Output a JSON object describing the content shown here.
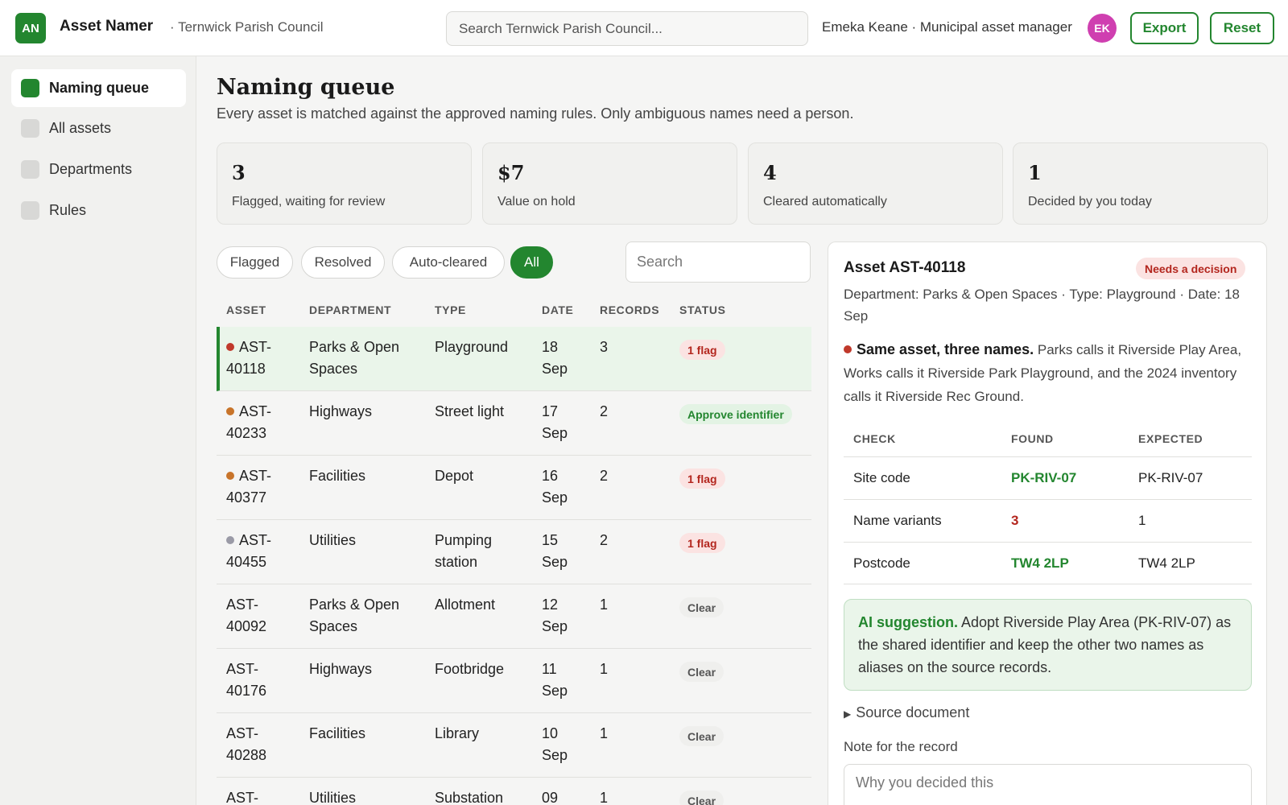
{
  "app": {
    "logo_text": "AN",
    "title": "Asset Namer",
    "org": "· Ternwick Parish Council",
    "search_placeholder": "Search Ternwick Parish Council...",
    "user_line": "Emeka Keane · Municipal asset manager",
    "avatar": "EK",
    "export_label": "Export",
    "reset_label": "Reset"
  },
  "sidebar": {
    "items": [
      {
        "label": "Naming queue",
        "active": true
      },
      {
        "label": "All assets",
        "active": false
      },
      {
        "label": "Departments",
        "active": false
      },
      {
        "label": "Rules",
        "active": false
      }
    ]
  },
  "main": {
    "title": "Naming queue",
    "subtitle": "Every asset is matched against the approved naming rules. Only ambiguous names need a person.",
    "stats": [
      {
        "value": "3",
        "label": "Flagged, waiting for review"
      },
      {
        "value": "$7",
        "label": "Value on hold"
      },
      {
        "value": "4",
        "label": "Cleared automatically"
      },
      {
        "value": "1",
        "label": "Decided by you today"
      }
    ],
    "filters": [
      "Flagged",
      "Resolved",
      "Auto-cleared",
      "All"
    ],
    "active_filter": "All",
    "list_search_placeholder": "Search"
  },
  "table": {
    "columns": [
      "ASSET",
      "DEPARTMENT",
      "TYPE",
      "DATE",
      "RECORDS",
      "STATUS"
    ],
    "rows": [
      {
        "asset_a": "AST-",
        "asset_b": "40118",
        "dot": "#c0392b",
        "dept_a": "Parks & Open",
        "dept_b": "Spaces",
        "type_a": "Playground",
        "type_b": "",
        "date_a": "18",
        "date_b": "Sep",
        "records": "3",
        "status": "1 flag",
        "status_kind": "flag",
        "selected": true
      },
      {
        "asset_a": "AST-",
        "asset_b": "40233",
        "dot": "#c8742a",
        "dept_a": "Highways",
        "dept_b": "",
        "type_a": "Street light",
        "type_b": "",
        "date_a": "17",
        "date_b": "Sep",
        "records": "2",
        "status": "Approve identifier",
        "status_kind": "approve",
        "selected": false
      },
      {
        "asset_a": "AST-",
        "asset_b": "40377",
        "dot": "#c8742a",
        "dept_a": "Facilities",
        "dept_b": "",
        "type_a": "Depot",
        "type_b": "",
        "date_a": "16",
        "date_b": "Sep",
        "records": "2",
        "status": "1 flag",
        "status_kind": "flag",
        "selected": false
      },
      {
        "asset_a": "AST-",
        "asset_b": "40455",
        "dot": "#9a9aa6",
        "dept_a": "Utilities",
        "dept_b": "",
        "type_a": "Pumping",
        "type_b": "station",
        "date_a": "15",
        "date_b": "Sep",
        "records": "2",
        "status": "1 flag",
        "status_kind": "flag",
        "selected": false
      },
      {
        "asset_a": "AST-",
        "asset_b": "40092",
        "dot": "",
        "dept_a": "Parks & Open",
        "dept_b": "Spaces",
        "type_a": "Allotment",
        "type_b": "",
        "date_a": "12",
        "date_b": "Sep",
        "records": "1",
        "status": "Clear",
        "status_kind": "clear",
        "selected": false
      },
      {
        "asset_a": "AST-",
        "asset_b": "40176",
        "dot": "",
        "dept_a": "Highways",
        "dept_b": "",
        "type_a": "Footbridge",
        "type_b": "",
        "date_a": "11",
        "date_b": "Sep",
        "records": "1",
        "status": "Clear",
        "status_kind": "clear",
        "selected": false
      },
      {
        "asset_a": "AST-",
        "asset_b": "40288",
        "dot": "",
        "dept_a": "Facilities",
        "dept_b": "",
        "type_a": "Library",
        "type_b": "",
        "date_a": "10",
        "date_b": "Sep",
        "records": "1",
        "status": "Clear",
        "status_kind": "clear",
        "selected": false
      },
      {
        "asset_a": "AST-",
        "asset_b": "",
        "dot": "",
        "dept_a": "Utilities",
        "dept_b": "",
        "type_a": "Substation",
        "type_b": "",
        "date_a": "09",
        "date_b": "",
        "records": "1",
        "status": "Clear",
        "status_kind": "clear",
        "selected": false
      }
    ]
  },
  "detail": {
    "title": "Asset AST-40118",
    "status": "Needs a decision",
    "meta": "Department: Parks & Open Spaces · Type: Playground · Date: 18 Sep",
    "issue_title": "Same asset, three names.",
    "issue_text": "Parks calls it Riverside Play Area, Works calls it Riverside Park Playground, and the 2024 inventory calls it Riverside Rec Ground.",
    "check_columns": [
      "CHECK",
      "FOUND",
      "EXPECTED"
    ],
    "checks": [
      {
        "check": "Site code",
        "found": "PK-RIV-07",
        "expected": "PK-RIV-07",
        "ok": true
      },
      {
        "check": "Name variants",
        "found": "3",
        "expected": "1",
        "ok": false
      },
      {
        "check": "Postcode",
        "found": "TW4 2LP",
        "expected": "TW4 2LP",
        "ok": true
      }
    ],
    "ai_label": "AI suggestion.",
    "ai_text": "Adopt Riverside Play Area (PK-RIV-07) as the shared identifier and keep the other two names as aliases on the source records.",
    "source_label": "Source document",
    "note_label": "Note for the record",
    "note_placeholder": "Why you decided this"
  },
  "colors": {
    "accent": "#23862f",
    "flag": "#b3261e",
    "avatar": "#cf3fb0"
  }
}
